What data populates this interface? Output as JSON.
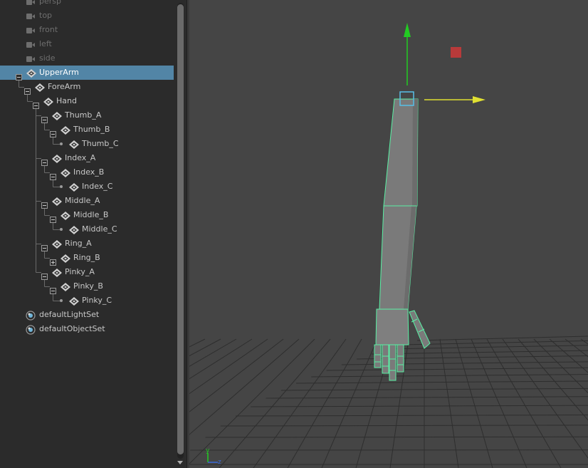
{
  "outliner": {
    "items": [
      {
        "label": "persp",
        "kind": "camera",
        "depth": 0
      },
      {
        "label": "top",
        "kind": "camera",
        "depth": 0
      },
      {
        "label": "front",
        "kind": "camera",
        "depth": 0
      },
      {
        "label": "left",
        "kind": "camera",
        "depth": 0
      },
      {
        "label": "side",
        "kind": "camera",
        "depth": 0
      },
      {
        "label": "UpperArm",
        "kind": "transform",
        "depth": 0,
        "expanded": true,
        "selected": true
      },
      {
        "label": "ForeArm",
        "kind": "transform",
        "depth": 1,
        "expanded": true
      },
      {
        "label": "Hand",
        "kind": "transform",
        "depth": 2,
        "expanded": true
      },
      {
        "label": "Thumb_A",
        "kind": "transform",
        "depth": 3,
        "expanded": true
      },
      {
        "label": "Thumb_B",
        "kind": "transform",
        "depth": 4,
        "expanded": true
      },
      {
        "label": "Thumb_C",
        "kind": "transform",
        "depth": 5,
        "leaf": true
      },
      {
        "label": "Index_A",
        "kind": "transform",
        "depth": 3,
        "expanded": true
      },
      {
        "label": "Index_B",
        "kind": "transform",
        "depth": 4,
        "expanded": true
      },
      {
        "label": "Index_C",
        "kind": "transform",
        "depth": 5,
        "leaf": true
      },
      {
        "label": "Middle_A",
        "kind": "transform",
        "depth": 3,
        "expanded": true
      },
      {
        "label": "Middle_B",
        "kind": "transform",
        "depth": 4,
        "expanded": true
      },
      {
        "label": "Middle_C",
        "kind": "transform",
        "depth": 5,
        "leaf": true
      },
      {
        "label": "Ring_A",
        "kind": "transform",
        "depth": 3,
        "expanded": true
      },
      {
        "label": "Ring_B",
        "kind": "transform",
        "depth": 4,
        "expanded": false
      },
      {
        "label": "Pinky_A",
        "kind": "transform",
        "depth": 3,
        "expanded": true
      },
      {
        "label": "Pinky_B",
        "kind": "transform",
        "depth": 4,
        "expanded": true
      },
      {
        "label": "Pinky_C",
        "kind": "transform",
        "depth": 5,
        "leaf": true
      },
      {
        "label": "defaultLightSet",
        "kind": "set",
        "depth": 0
      },
      {
        "label": "defaultObjectSet",
        "kind": "set",
        "depth": 0
      }
    ]
  },
  "viewport": {
    "axis_labels": {
      "y": "y",
      "z": "z"
    },
    "colors": {
      "background": "#454545",
      "grid": "#2e2e2e",
      "mesh_fill": "#7a7a7a",
      "selection_wire": "#59f0a4",
      "manipulator_y": "#22cc22",
      "manipulator_x": "#e0e032",
      "manipulator_center": "#b83a3a"
    }
  },
  "colors": {
    "outliner_bg": "#2b2b2b",
    "selected_row": "#5285a6",
    "text": "#c8c8c8",
    "camera_text": "#6e6e6e"
  }
}
